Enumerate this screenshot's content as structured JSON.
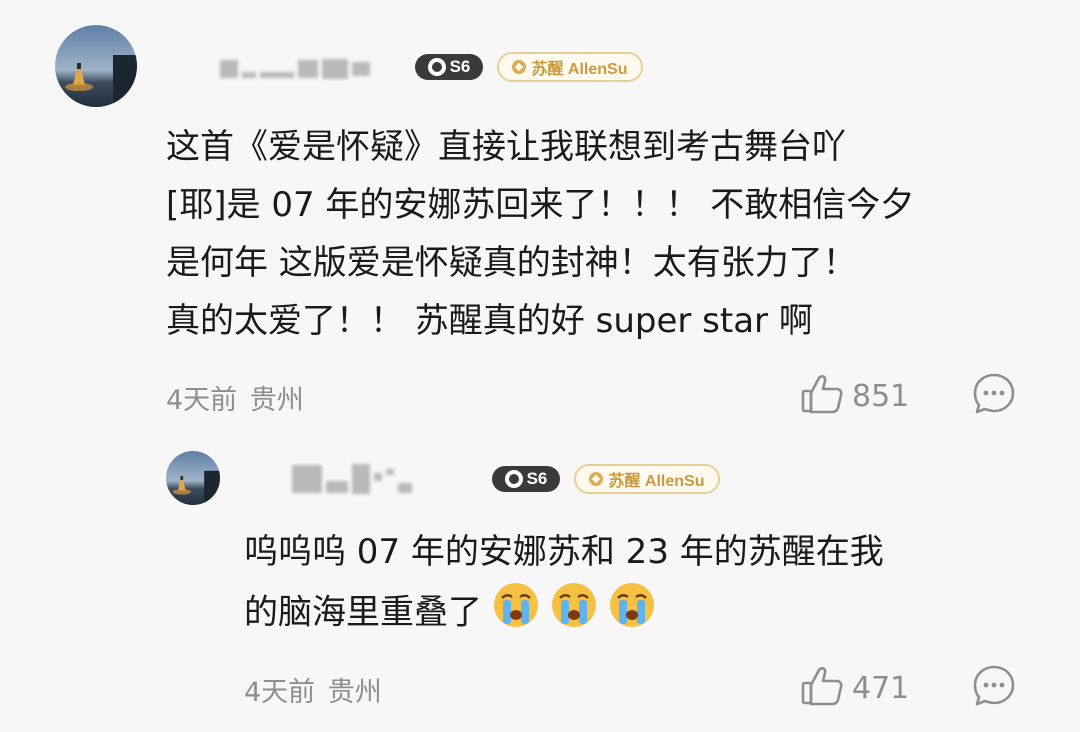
{
  "comments": [
    {
      "badge_level": "S6",
      "fan_badge": "苏醒 AllenSu",
      "text_lines": [
        "这首《爱是怀疑》直接让我联想到考古舞台吖",
        "[耶]是 07 年的安娜苏回来了！！！ 不敢相信今夕",
        "是何年 这版爱是怀疑真的封神！太有张力了！",
        "真的太爱了！！ 苏醒真的好 super star 啊"
      ],
      "time": "4天前",
      "location": "贵州",
      "likes": "851"
    },
    {
      "badge_level": "S6",
      "fan_badge": "苏醒 AllenSu",
      "text_lines": [
        "呜呜呜 07 年的安娜苏和 23 年的苏醒在我",
        "的脑海里重叠了"
      ],
      "emojis": [
        "crying-face",
        "crying-face",
        "crying-face"
      ],
      "time": "4天前",
      "location": "贵州",
      "likes": "471"
    }
  ],
  "colors": {
    "text": "#1a1a1a",
    "meta": "#8e8e8e",
    "badge_dark": "#3a3a3a",
    "fan_gold": "#c99a3f",
    "background": "#f7f7f7"
  }
}
